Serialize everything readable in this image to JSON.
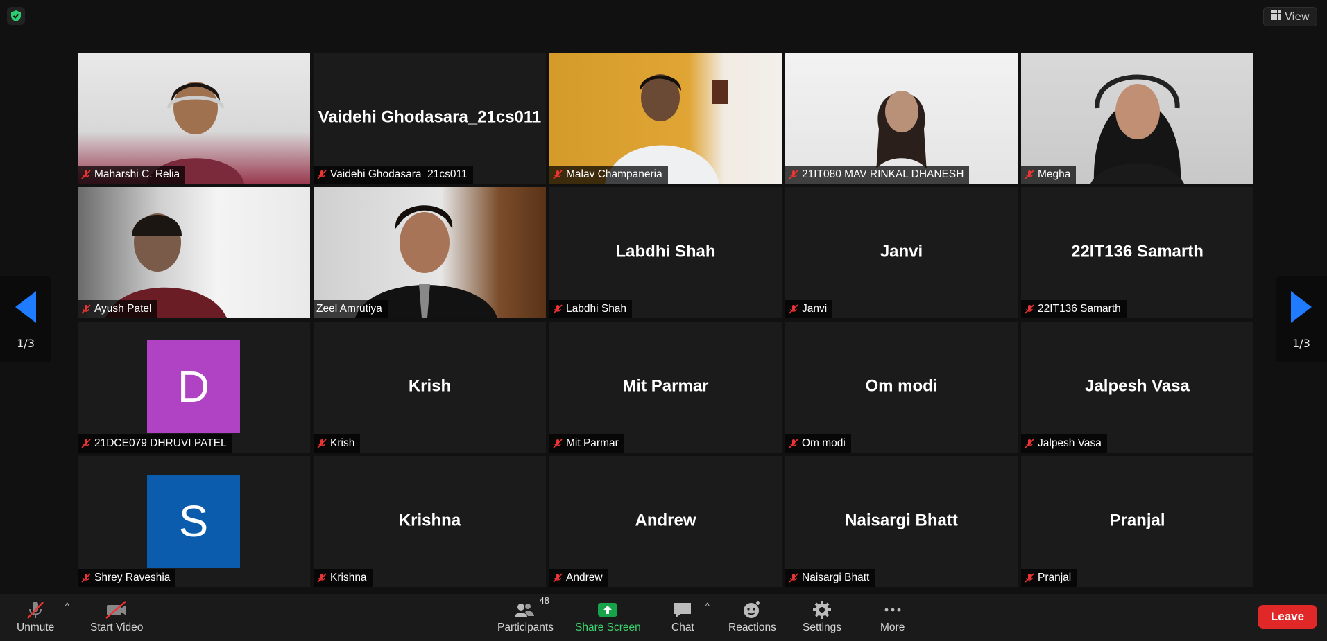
{
  "header": {
    "view_label": "View"
  },
  "pagination": {
    "left": "1/3",
    "right": "1/3"
  },
  "tiles": [
    {
      "label": "Maharshi C. Relia",
      "center": ""
    },
    {
      "label": "Vaidehi Ghodasara_21cs011",
      "center": "Vaidehi Ghodasara_21cs011"
    },
    {
      "label": "Malav Champaneria",
      "center": ""
    },
    {
      "label": "21IT080 MAV RINKAL DHANESH",
      "center": ""
    },
    {
      "label": "Megha",
      "center": ""
    },
    {
      "label": "Ayush Patel",
      "center": ""
    },
    {
      "label": "Zeel Amrutiya",
      "center": ""
    },
    {
      "label": "Labdhi Shah",
      "center": "Labdhi Shah"
    },
    {
      "label": "Janvi",
      "center": "Janvi"
    },
    {
      "label": "22IT136 Samarth",
      "center": "22IT136 Samarth"
    },
    {
      "label": "21DCE079 DHRUVI PATEL",
      "center": "",
      "avatar": "D",
      "avatar_color": "#b043c4"
    },
    {
      "label": "Krish",
      "center": "Krish"
    },
    {
      "label": "Mit Parmar",
      "center": "Mit Parmar"
    },
    {
      "label": "Om modi",
      "center": "Om modi"
    },
    {
      "label": "Jalpesh Vasa",
      "center": "Jalpesh Vasa"
    },
    {
      "label": "Shrey Raveshia",
      "center": "",
      "avatar": "S",
      "avatar_color": "#0b5cad"
    },
    {
      "label": "Krishna",
      "center": "Krishna"
    },
    {
      "label": "Andrew",
      "center": "Andrew"
    },
    {
      "label": "Naisargi Bhatt",
      "center": "Naisargi Bhatt"
    },
    {
      "label": "Pranjal",
      "center": "Pranjal"
    }
  ],
  "toolbar": {
    "unmute": "Unmute",
    "start_video": "Start Video",
    "participants": "Participants",
    "participants_count": "48",
    "share_screen": "Share Screen",
    "chat": "Chat",
    "reactions": "Reactions",
    "settings": "Settings",
    "more": "More",
    "leave": "Leave"
  },
  "colors": {
    "active_speaker": "#b7e066",
    "share_green": "#3ed36b",
    "leave_red": "#e02828",
    "nav_blue": "#1f7bff"
  }
}
